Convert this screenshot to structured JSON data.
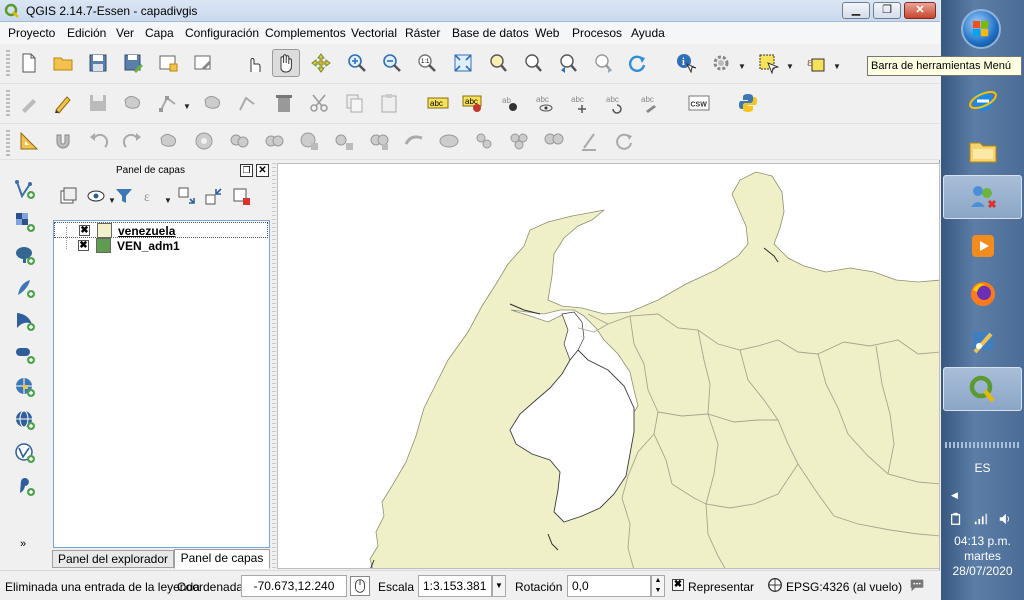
{
  "window": {
    "title": "QGIS 2.14.7-Essen - capadivgis",
    "buttons": {
      "minimize": "▁",
      "maximize": "❐",
      "close": "✕"
    }
  },
  "menu": {
    "items": [
      "Proyecto",
      "Edición",
      "Ver",
      "Capa",
      "Configuración",
      "Complementos",
      "Vectorial",
      "Ráster",
      "Base de datos",
      "Web",
      "Procesos",
      "Ayuda"
    ]
  },
  "tooltip": "Barra de herramientas Menú",
  "toolbar": {
    "csw_label": "CSW",
    "label_tools": [
      "abc",
      "abc",
      "ab",
      "abc",
      "abc",
      "abc",
      "abc"
    ]
  },
  "layers_panel": {
    "title": "Panel de capas",
    "layers": [
      {
        "name": "venezuela",
        "checked": "✖",
        "color": "#f2f1cc"
      },
      {
        "name": "VEN_adm1",
        "checked": "✖",
        "color": "#5f9c52"
      }
    ],
    "tabs": [
      "Panel del explorador",
      "Panel de capas"
    ]
  },
  "left_toolbar": {
    "more": "»"
  },
  "map": {
    "land_color": "#f0f0c8",
    "border_color": "#a6a58c"
  },
  "status": {
    "message": "Eliminada una entrada de la leyenda",
    "coord_label": "Coordenada",
    "coord_value": "-70.673,12.240",
    "scale_label": "Escala",
    "scale_value": "1:3.153.381",
    "rotation_label": "Rotación",
    "rotation_value": "0,0",
    "render_label": "Representar",
    "render_checked": "✖",
    "crs": "EPSG:4326 (al vuelo)"
  },
  "taskbar": {
    "language": "ES",
    "time": "04:13 p.m.",
    "day": "martes",
    "date": "28/07/2020"
  }
}
